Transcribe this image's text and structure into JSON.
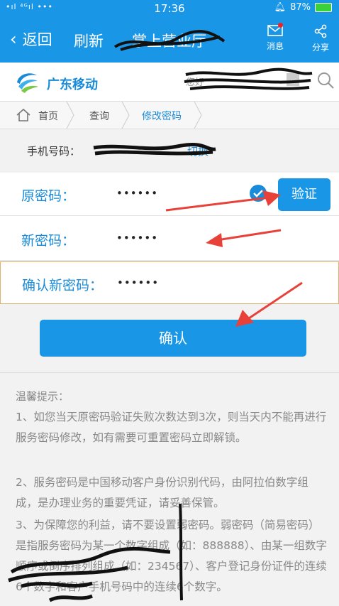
{
  "status_bar": {
    "left": "•ıl ⁴ᴳıl •••",
    "time": "17:36",
    "battery": "87%"
  },
  "app_bar": {
    "back_label": "返回",
    "refresh_label": "刷新",
    "title": "掌上营业厅",
    "message_label": "消息",
    "share_label": "分享"
  },
  "brand": {
    "name": "广东移动",
    "search_placeholder": "您好"
  },
  "breadcrumb": {
    "home": "首页",
    "query": "查询",
    "current": "修改密码"
  },
  "phone": {
    "label": "手机号码：",
    "switch_label": "切换"
  },
  "form": {
    "old_password_label": "原密码：",
    "old_password_value": "••••••",
    "verify_label": "验证",
    "new_password_label": "新密码：",
    "new_password_value": "••••••",
    "confirm_password_label": "确认新密码：",
    "confirm_password_value": "••••••",
    "confirm_button": "确认"
  },
  "tips": {
    "title": "温馨提示：",
    "items": [
      "1、如您当天原密码验证失败次数达到3次，则当天内不能再进行服务密码修改，如有需要可重置密码立即解锁。",
      "2、服务密码是中国移动客户身份识别代码，由阿拉伯数字组成，是办理业务的重要凭证，请妥善保管。",
      "3、为保障您的利益，请不要设置弱密码。弱密码（简易密码）是指服务密码为某一个数字组成（如：888888）、由某一组数字顺序或倒序排列组成（如：234567）、客户登记身份证件的连续6个数字和客户手机号码中的连续6个数字。"
    ]
  },
  "colors": {
    "primary": "#1a96e6",
    "link": "#1a8bd8",
    "annotation_arrow": "#e8413a"
  }
}
